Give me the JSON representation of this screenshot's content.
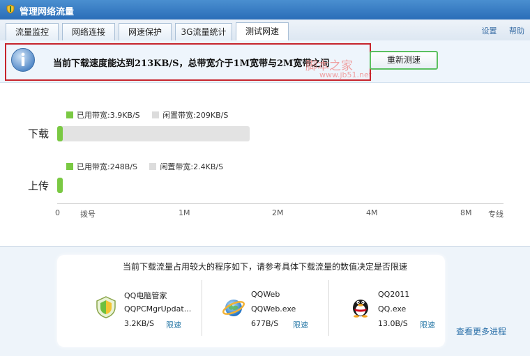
{
  "window": {
    "title": "管理网络流量"
  },
  "tabs": [
    {
      "label": "流量监控"
    },
    {
      "label": "网络连接"
    },
    {
      "label": "网速保护"
    },
    {
      "label": "3G流量统计"
    },
    {
      "label": "测试网速"
    }
  ],
  "top_links": [
    "设置",
    "帮助"
  ],
  "banner": {
    "message": "当前下载速度能达到213KB/S，总带宽介于1M宽带与2M宽带之间",
    "retest_label": "重新测速"
  },
  "watermark": {
    "line1": "脚本之家",
    "line2": "www.jb51.net"
  },
  "speed_chart": {
    "rows": [
      {
        "label": "下载",
        "used_label": "已用带宽:3.9KB/S",
        "idle_label": "闲置带宽:209KB/S"
      },
      {
        "label": "上传",
        "used_label": "已用带宽:248B/S",
        "idle_label": "闲置带宽:2.4KB/S"
      }
    ],
    "ticks": [
      "0",
      "拨号",
      "1M",
      "2M",
      "4M",
      "8M",
      "专线"
    ],
    "colors": {
      "used": "#7ac943",
      "idle": "#e3e3e3"
    }
  },
  "programs": {
    "title": "当前下载流量占用较大的程序如下，请参考具体下载流量的数值决定是否限速",
    "limit_label": "限速",
    "more_label": "查看更多进程",
    "items": [
      {
        "name": "QQ电脑管家",
        "exe": "QQPCMgrUpdat...",
        "speed": "3.2KB/S",
        "icon": "qq-pc-manager-icon"
      },
      {
        "name": "QQWeb",
        "exe": "QQWeb.exe",
        "speed": "677B/S",
        "icon": "ie-globe-icon"
      },
      {
        "name": "QQ2011",
        "exe": "QQ.exe",
        "speed": "13.0B/S",
        "icon": "qq-penguin-icon"
      }
    ]
  }
}
